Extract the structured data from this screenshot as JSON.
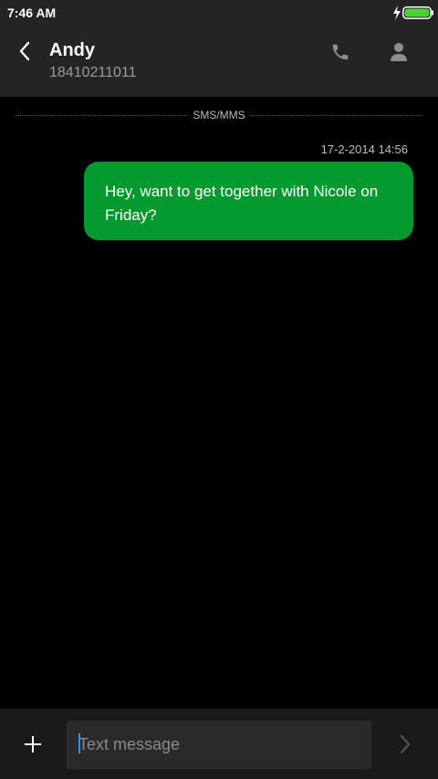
{
  "status_bar": {
    "time": "7:46 AM",
    "icons": [
      "charging-icon",
      "battery-icon"
    ],
    "battery_color": "#4cd137"
  },
  "header": {
    "contact_name": "Andy",
    "contact_number": "18410211011",
    "icons": [
      "back-arrow-icon",
      "phone-icon",
      "person-icon"
    ]
  },
  "thread": {
    "channel_label": "SMS/MMS",
    "messages": [
      {
        "timestamp": "17-2-2014 14:56",
        "text": "Hey, want to get together with Nicole on Friday?",
        "direction": "outgoing",
        "bubble_color": "#02992e"
      }
    ]
  },
  "composer": {
    "placeholder": "Text message",
    "value": "",
    "icons": [
      "plus-icon",
      "send-arrow-icon"
    ]
  },
  "colors": {
    "background": "#000000",
    "bars": "#242424",
    "accent_caret": "#2196f3"
  }
}
